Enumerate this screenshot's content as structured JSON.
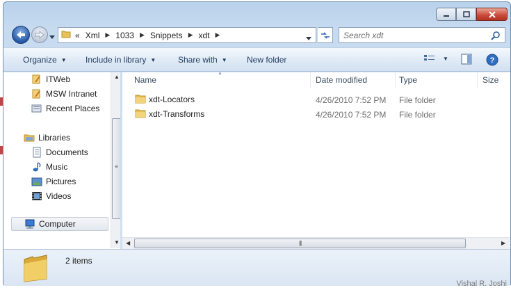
{
  "window": {
    "accent": "#2457a6"
  },
  "address": {
    "overflow_glyph": "«",
    "crumbs": [
      "Xml",
      "1033",
      "Snippets",
      "xdt"
    ]
  },
  "search": {
    "placeholder": "Search xdt"
  },
  "toolbar": {
    "organize": "Organize",
    "include_in_library": "Include in library",
    "share_with": "Share with",
    "new_folder": "New folder"
  },
  "nav": {
    "items": [
      {
        "label": "ITWeb",
        "icon": "network-place-icon"
      },
      {
        "label": "MSW Intranet",
        "icon": "network-place-icon"
      },
      {
        "label": "Recent Places",
        "icon": "recent-places-icon"
      },
      {
        "label": "Libraries",
        "icon": "libraries-icon"
      },
      {
        "label": "Documents",
        "icon": "documents-icon"
      },
      {
        "label": "Music",
        "icon": "music-icon"
      },
      {
        "label": "Pictures",
        "icon": "pictures-icon"
      },
      {
        "label": "Videos",
        "icon": "videos-icon"
      },
      {
        "label": "Computer",
        "icon": "computer-icon"
      }
    ]
  },
  "columns": {
    "name": "Name",
    "date_modified": "Date modified",
    "type": "Type",
    "size": "Size"
  },
  "files": [
    {
      "name": "xdt-Locators",
      "date": "4/26/2010 7:52 PM",
      "type": "File folder"
    },
    {
      "name": "xdt-Transforms",
      "date": "4/26/2010 7:52 PM",
      "type": "File folder"
    }
  ],
  "details": {
    "count": "2 items"
  },
  "watermark": "Vishal R. Joshi"
}
